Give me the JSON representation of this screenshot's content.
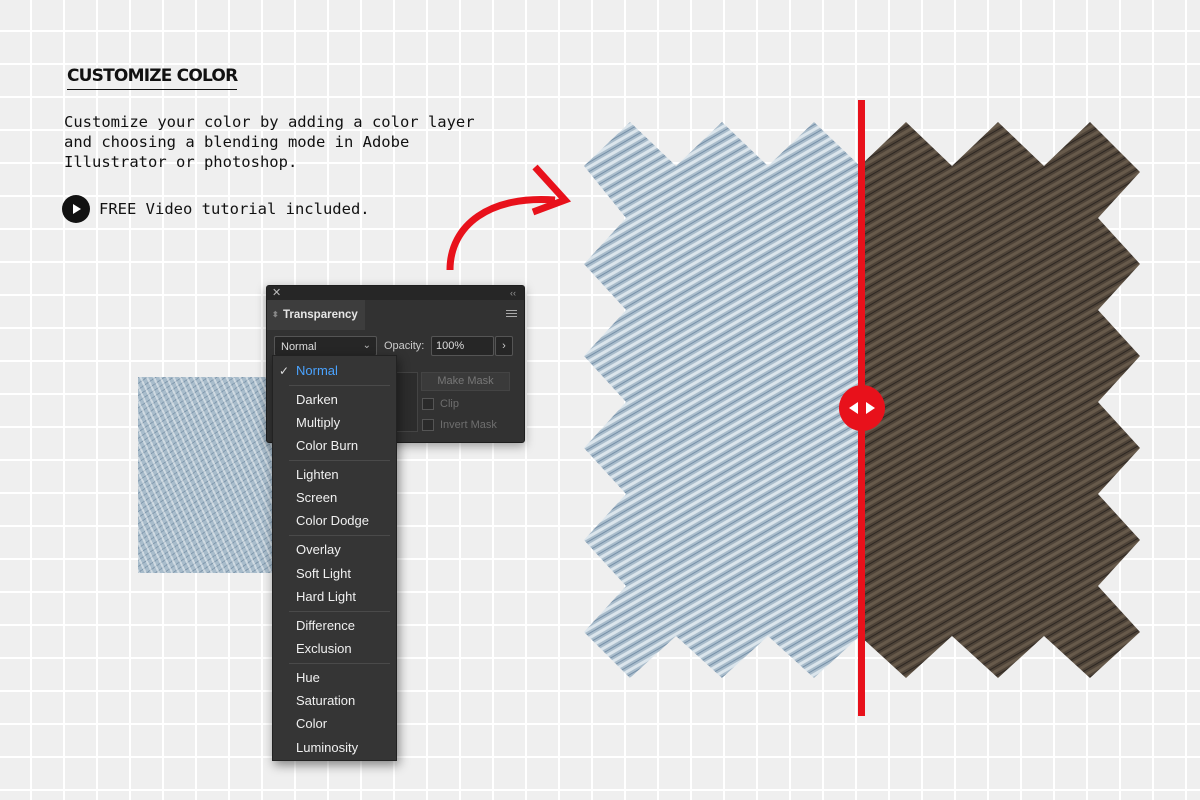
{
  "heading": "CUSTOMIZE COLOR",
  "description": "Customize your color by adding a color layer and choosing a blending mode in Adobe Illustrator or photoshop.",
  "video_label": "FREE Video tutorial included.",
  "panel": {
    "tab": "Transparency",
    "blend_mode": "Normal",
    "opacity_label": "Opacity:",
    "opacity_value": "100%",
    "make_mask": "Make Mask",
    "clip": "Clip",
    "invert_mask": "Invert Mask"
  },
  "blend_modes": [
    "Normal",
    "Darken",
    "Multiply",
    "Color Burn",
    "Lighten",
    "Screen",
    "Color Dodge",
    "Overlay",
    "Soft Light",
    "Hard Light",
    "Difference",
    "Exclusion",
    "Hue",
    "Saturation",
    "Color",
    "Luminosity"
  ],
  "colors": {
    "accent": "#e8111b",
    "denim": "#a8bccb",
    "brown": "#4d4238",
    "panel": "#323232",
    "selected": "#4aa3ff"
  }
}
